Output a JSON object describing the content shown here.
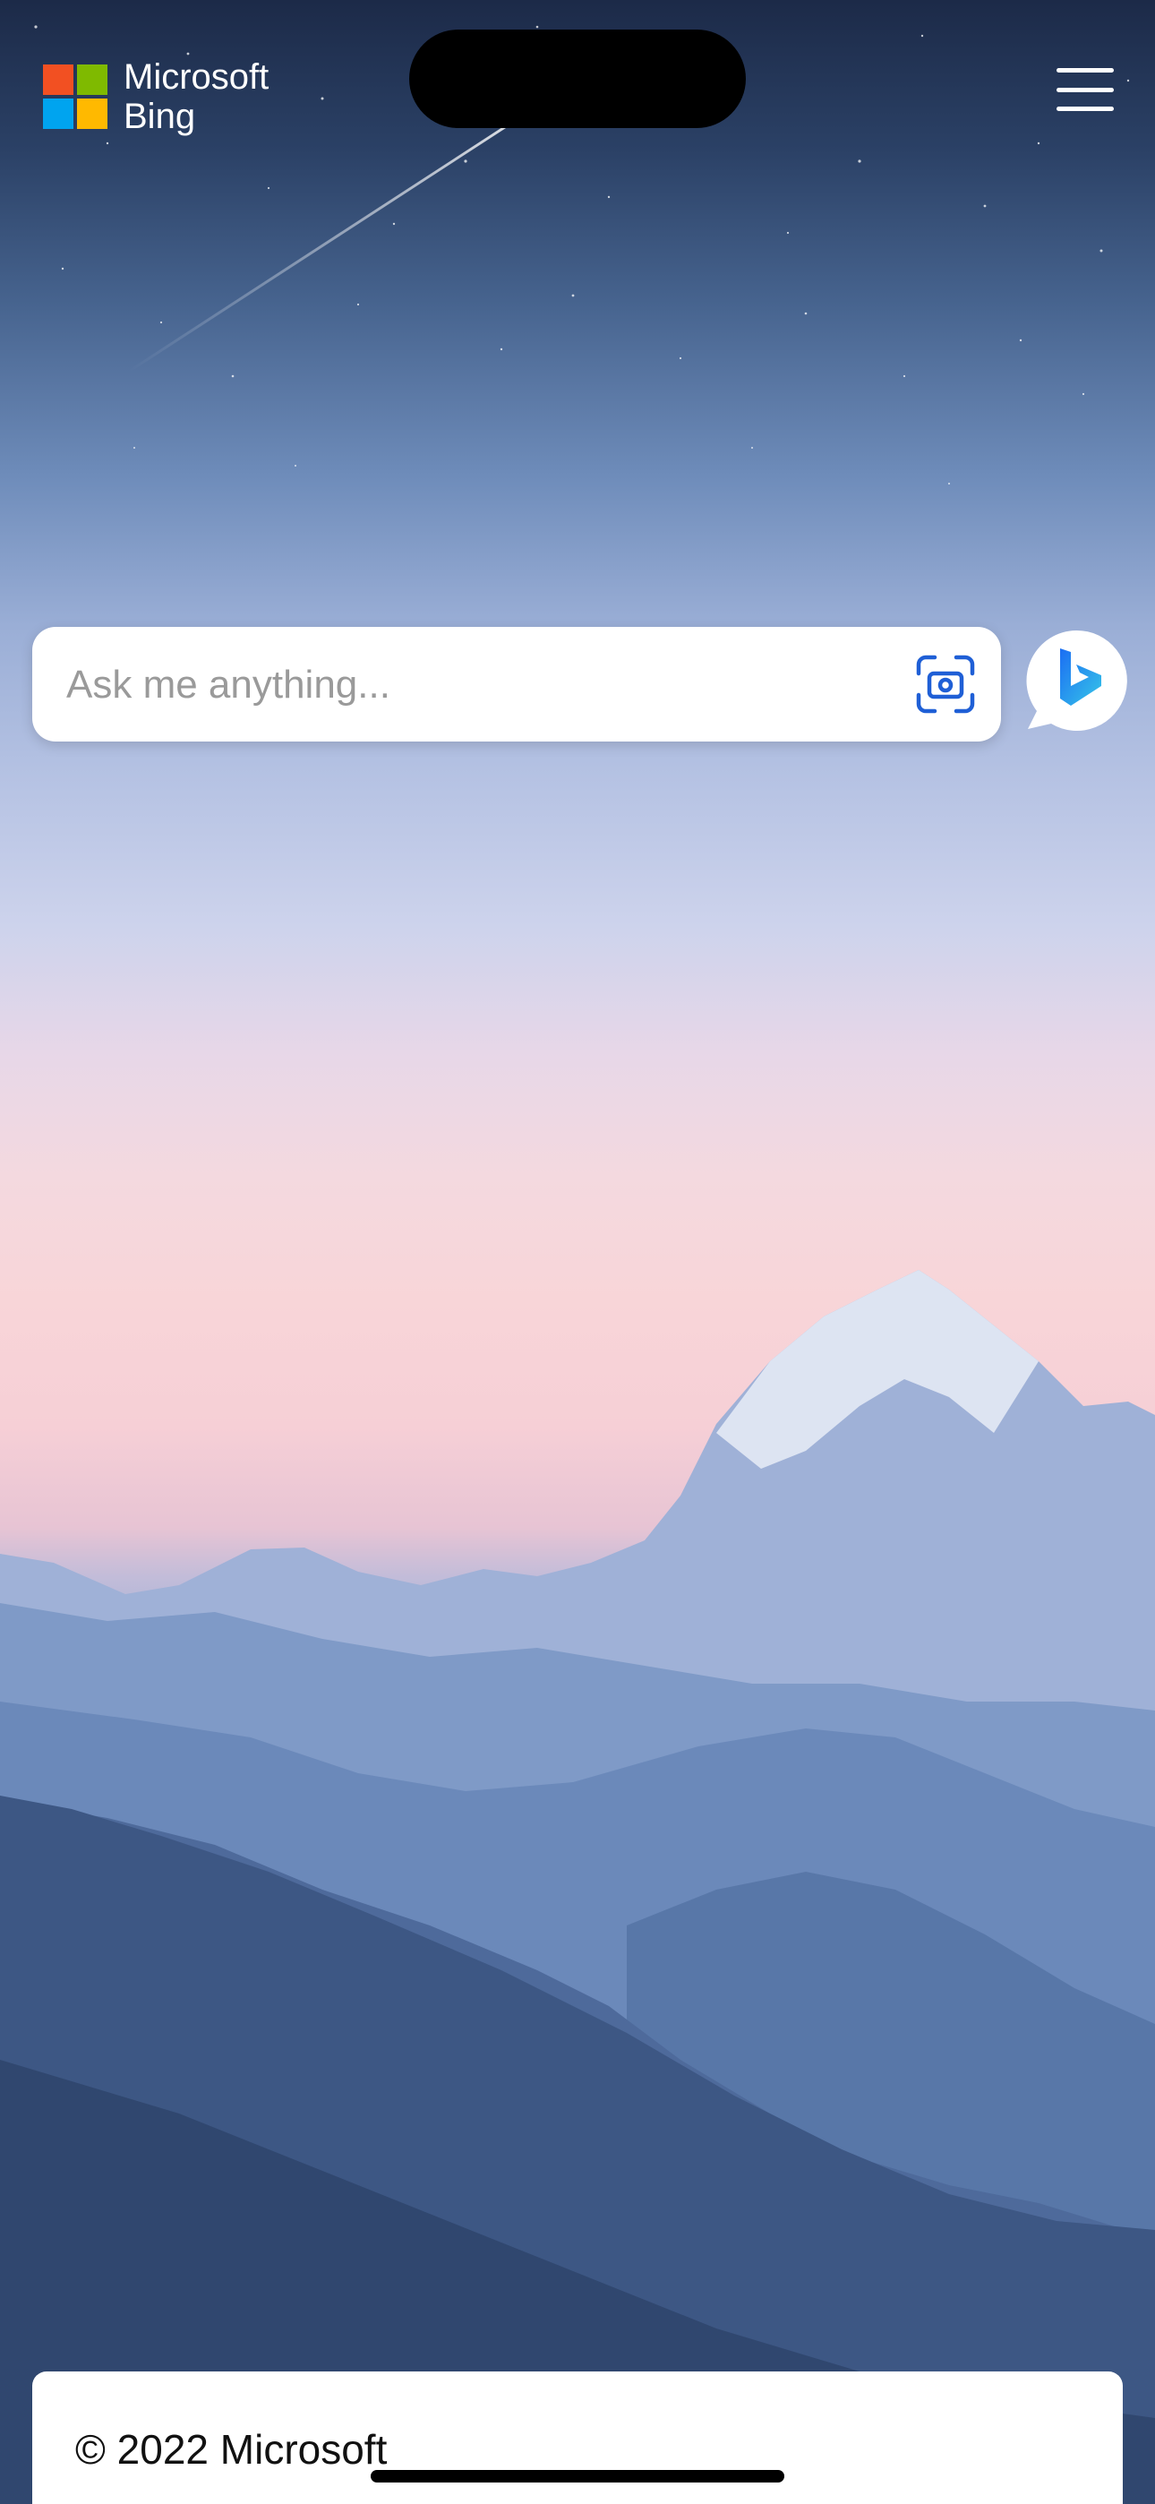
{
  "header": {
    "logo_line1": "Microsoft",
    "logo_line2": "Bing",
    "logo_colors": [
      "#f25022",
      "#7fba00",
      "#00a4ef",
      "#ffb900"
    ],
    "menu_icon": "hamburger-menu-icon"
  },
  "search": {
    "placeholder": "Ask me anything...",
    "value": "",
    "camera_icon": "visual-search-camera-icon"
  },
  "copilot": {
    "icon": "bing-chat-icon",
    "brand_color": "#1b6ef3"
  },
  "footer": {
    "copyright": "© 2022 Microsoft"
  }
}
